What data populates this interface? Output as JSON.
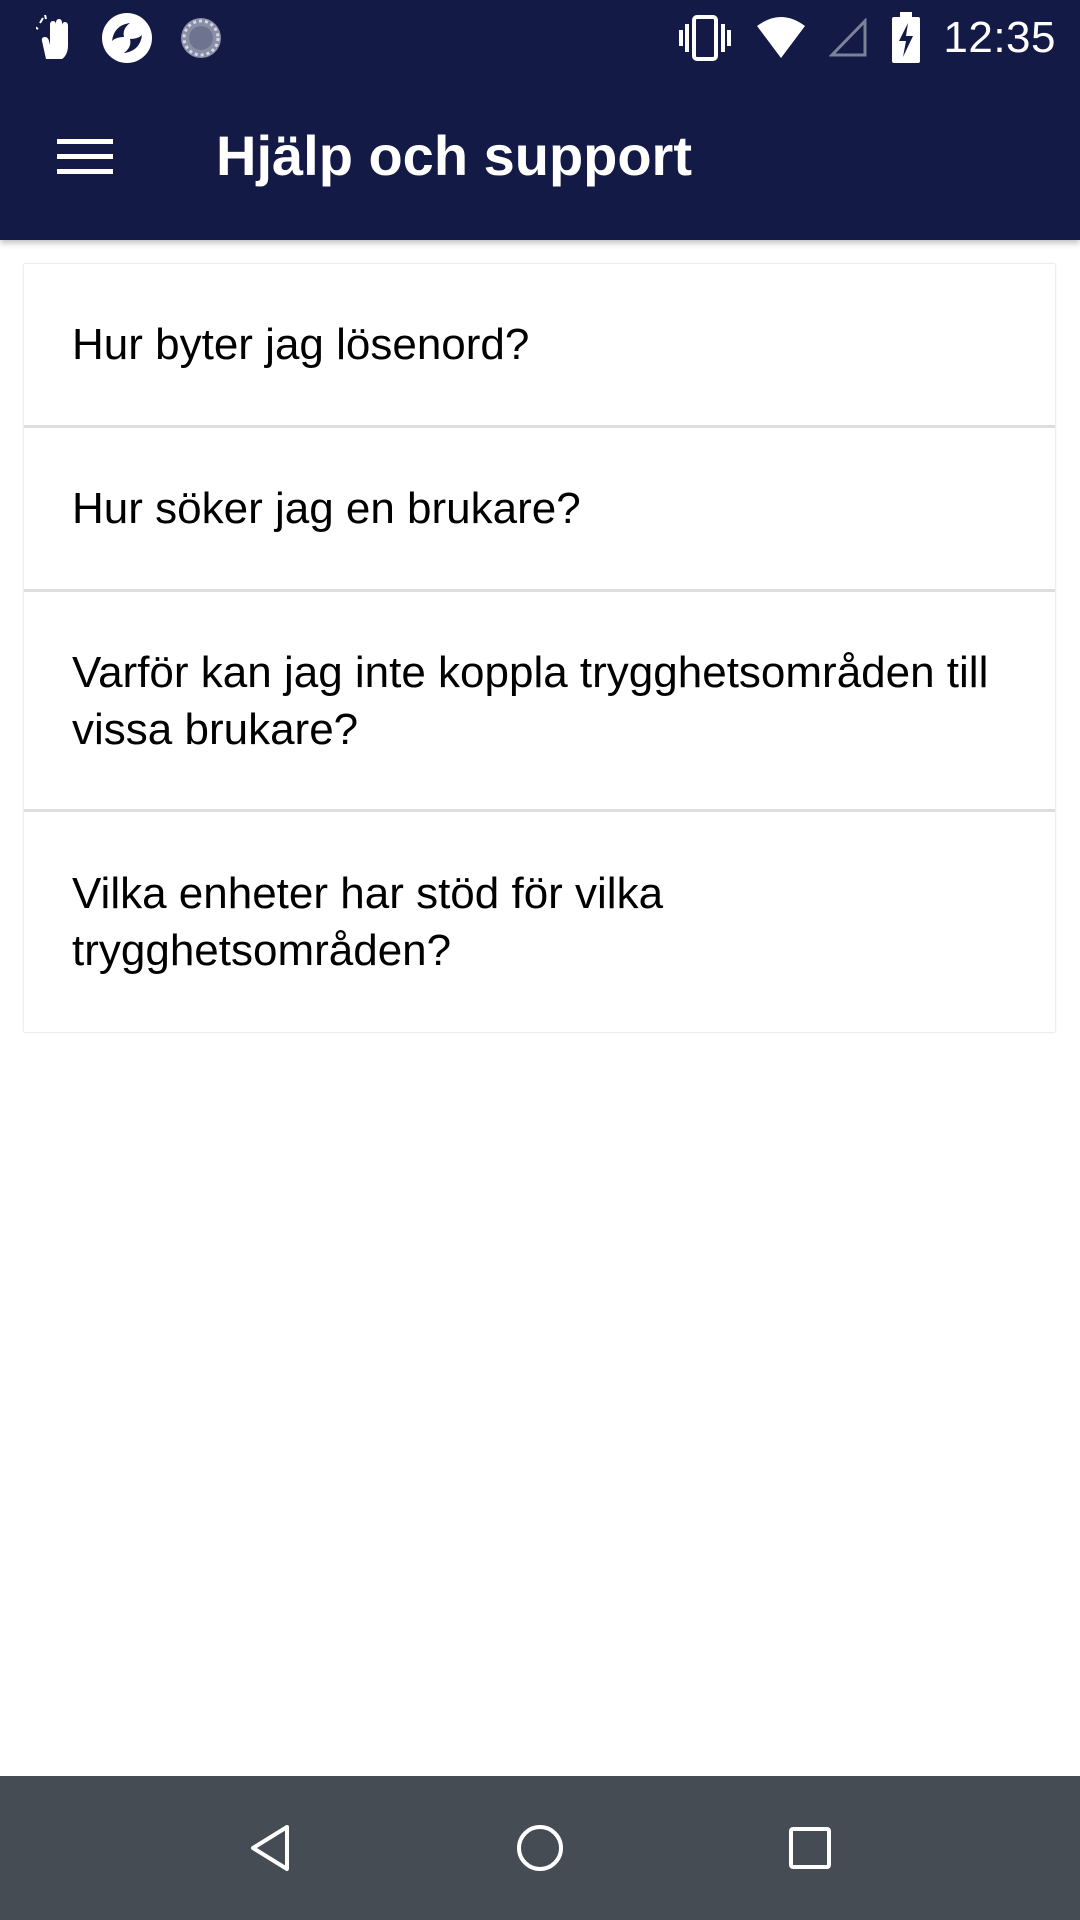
{
  "status_bar": {
    "time": "12:35",
    "left_icons": [
      "hand-notification-icon",
      "app-logo-notification-icon",
      "sync-spinner-icon"
    ],
    "right_icons": [
      "vibrate-icon",
      "wifi-icon",
      "cellular-signal-icon",
      "battery-charging-icon"
    ]
  },
  "app_bar": {
    "title": "Hjälp och support",
    "menu_icon": "hamburger-menu-icon"
  },
  "faq": {
    "items": [
      {
        "label": "Hur byter jag lösenord?"
      },
      {
        "label": "Hur söker jag en brukare?"
      },
      {
        "label": "Varför kan jag inte koppla trygghetsområden till vissa brukare?"
      },
      {
        "label": "Vilka enheter har stöd för vilka trygghetsområden?"
      }
    ]
  },
  "nav_bar": {
    "icons": [
      "back-icon",
      "home-icon",
      "recents-icon"
    ]
  },
  "colors": {
    "primary": "#131a45",
    "nav_bar": "#464c53",
    "divider": "#dedede"
  }
}
